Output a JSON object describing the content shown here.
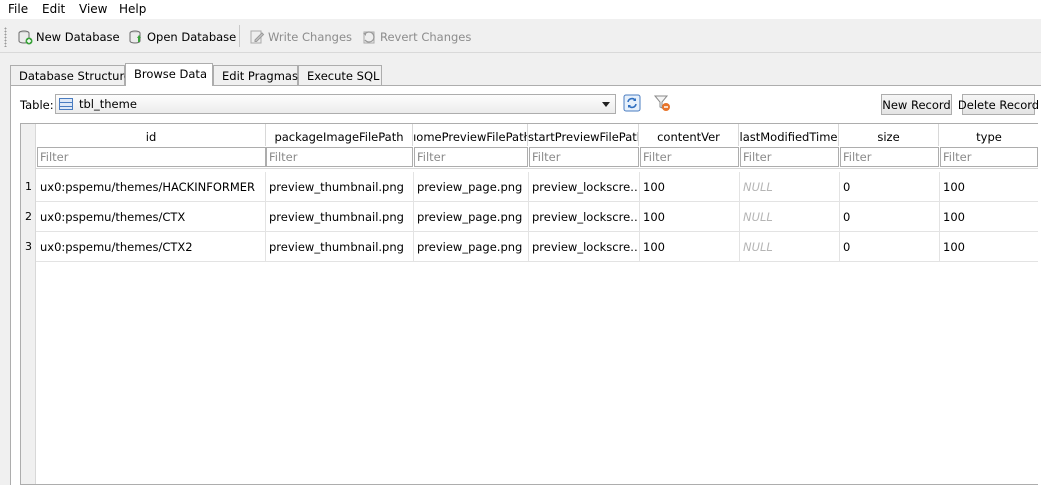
{
  "menubar": {
    "items": [
      "File",
      "Edit",
      "View",
      "Help"
    ]
  },
  "toolbar": {
    "new_db": "New Database",
    "open_db": "Open Database",
    "write": "Write Changes",
    "revert": "Revert Changes"
  },
  "tabs": [
    "Database Structure",
    "Browse Data",
    "Edit Pragmas",
    "Execute SQL"
  ],
  "active_tab": "Browse Data",
  "browse": {
    "table_label": "Table:",
    "table_value": "tbl_theme",
    "new_record": "New Record",
    "delete_record": "Delete Record",
    "filter_placeholder": "Filter",
    "columns": [
      "id",
      "packageImageFilePath",
      "homePreviewFilePath",
      "startPreviewFilePath",
      "contentVer",
      "lastModifiedTime",
      "size",
      "type"
    ],
    "column_headers_shown": [
      "id",
      "packageImageFilePath",
      "ıomePreviewFilePatł",
      "startPreviewFilePath",
      "contentVer",
      "lastModifiedTime",
      "size",
      "type"
    ],
    "rows": [
      {
        "num": "1",
        "cells": [
          "ux0:pspemu/themes/HACKINFORMER",
          "preview_thumbnail.png",
          "preview_page.png",
          "preview_lockscre…",
          "100",
          "NULL",
          "0",
          "100"
        ]
      },
      {
        "num": "2",
        "cells": [
          "ux0:pspemu/themes/CTX",
          "preview_thumbnail.png",
          "preview_page.png",
          "preview_lockscre…",
          "100",
          "NULL",
          "0",
          "100"
        ]
      },
      {
        "num": "3",
        "cells": [
          "ux0:pspemu/themes/CTX2",
          "preview_thumbnail.png",
          "preview_page.png",
          "preview_lockscre…",
          "100",
          "NULL",
          "0",
          "100"
        ]
      }
    ]
  },
  "icons": {
    "new_db": "new-database-icon",
    "open_db": "open-database-icon",
    "write": "write-changes-icon",
    "revert": "revert-changes-icon",
    "refresh": "refresh-icon",
    "clear_filters": "clear-filters-icon",
    "table": "table-icon"
  },
  "colors": {
    "accent": "#3a78c8",
    "null_text": "#b5b5b5",
    "grid_line": "#e3e3e3"
  }
}
